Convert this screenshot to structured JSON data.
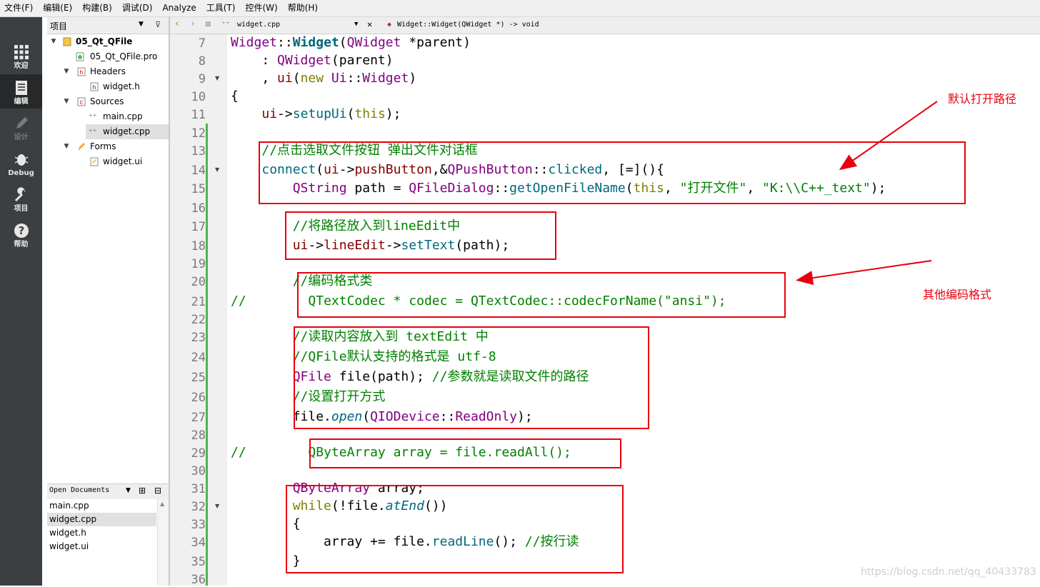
{
  "menu": [
    "文件(F)",
    "编辑(E)",
    "构建(B)",
    "调试(D)",
    "Analyze",
    "工具(T)",
    "控件(W)",
    "帮助(H)"
  ],
  "modes": [
    {
      "label": "欢迎",
      "icon": "grid-icon"
    },
    {
      "label": "编辑",
      "icon": "document-icon"
    },
    {
      "label": "设计",
      "icon": "pencil-icon"
    },
    {
      "label": "Debug",
      "icon": "bug-icon"
    },
    {
      "label": "项目",
      "icon": "wrench-icon"
    },
    {
      "label": "帮助",
      "icon": "help-icon"
    }
  ],
  "project_panel": {
    "title": "项目",
    "tree": [
      {
        "label": "05_Qt_QFile",
        "icon": "project-icon"
      },
      {
        "label": "05_Qt_QFile.pro",
        "icon": "pro-file-icon"
      },
      {
        "label": "Headers",
        "icon": "folder-icon"
      },
      {
        "label": "widget.h",
        "icon": "header-file-icon"
      },
      {
        "label": "Sources",
        "icon": "folder-icon"
      },
      {
        "label": "main.cpp",
        "icon": "cpp-file-icon"
      },
      {
        "label": "widget.cpp",
        "icon": "cpp-file-icon"
      },
      {
        "label": "Forms",
        "icon": "folder-icon"
      },
      {
        "label": "widget.ui",
        "icon": "ui-file-icon"
      }
    ]
  },
  "open_documents": {
    "title": "Open Documents",
    "items": [
      "main.cpp",
      "widget.cpp",
      "widget.h",
      "widget.ui"
    ]
  },
  "editor": {
    "file": "widget.cpp",
    "symbol": "Widget::Widget(QWidget *) -> void",
    "line_numbers": [
      "7",
      "8",
      "9",
      "10",
      "11",
      "12",
      "13",
      "14",
      "15",
      "16",
      "17",
      "18",
      "19",
      "20",
      "21",
      "22",
      "23",
      "24",
      "25",
      "26",
      "27",
      "28",
      "29",
      "30",
      "31",
      "32",
      "33",
      "34",
      "35",
      "36"
    ]
  },
  "annotations": {
    "default_path": "默认打开路径",
    "other_encoding": "其他编码格式"
  },
  "watermark": "https://blog.csdn.net/qq_40433783",
  "colors": {
    "annotation": "#e8000b",
    "sidebar": "#3c3f41",
    "comment": "#008000",
    "class": "#800080",
    "function": "#00677c",
    "keyword": "#808000"
  }
}
